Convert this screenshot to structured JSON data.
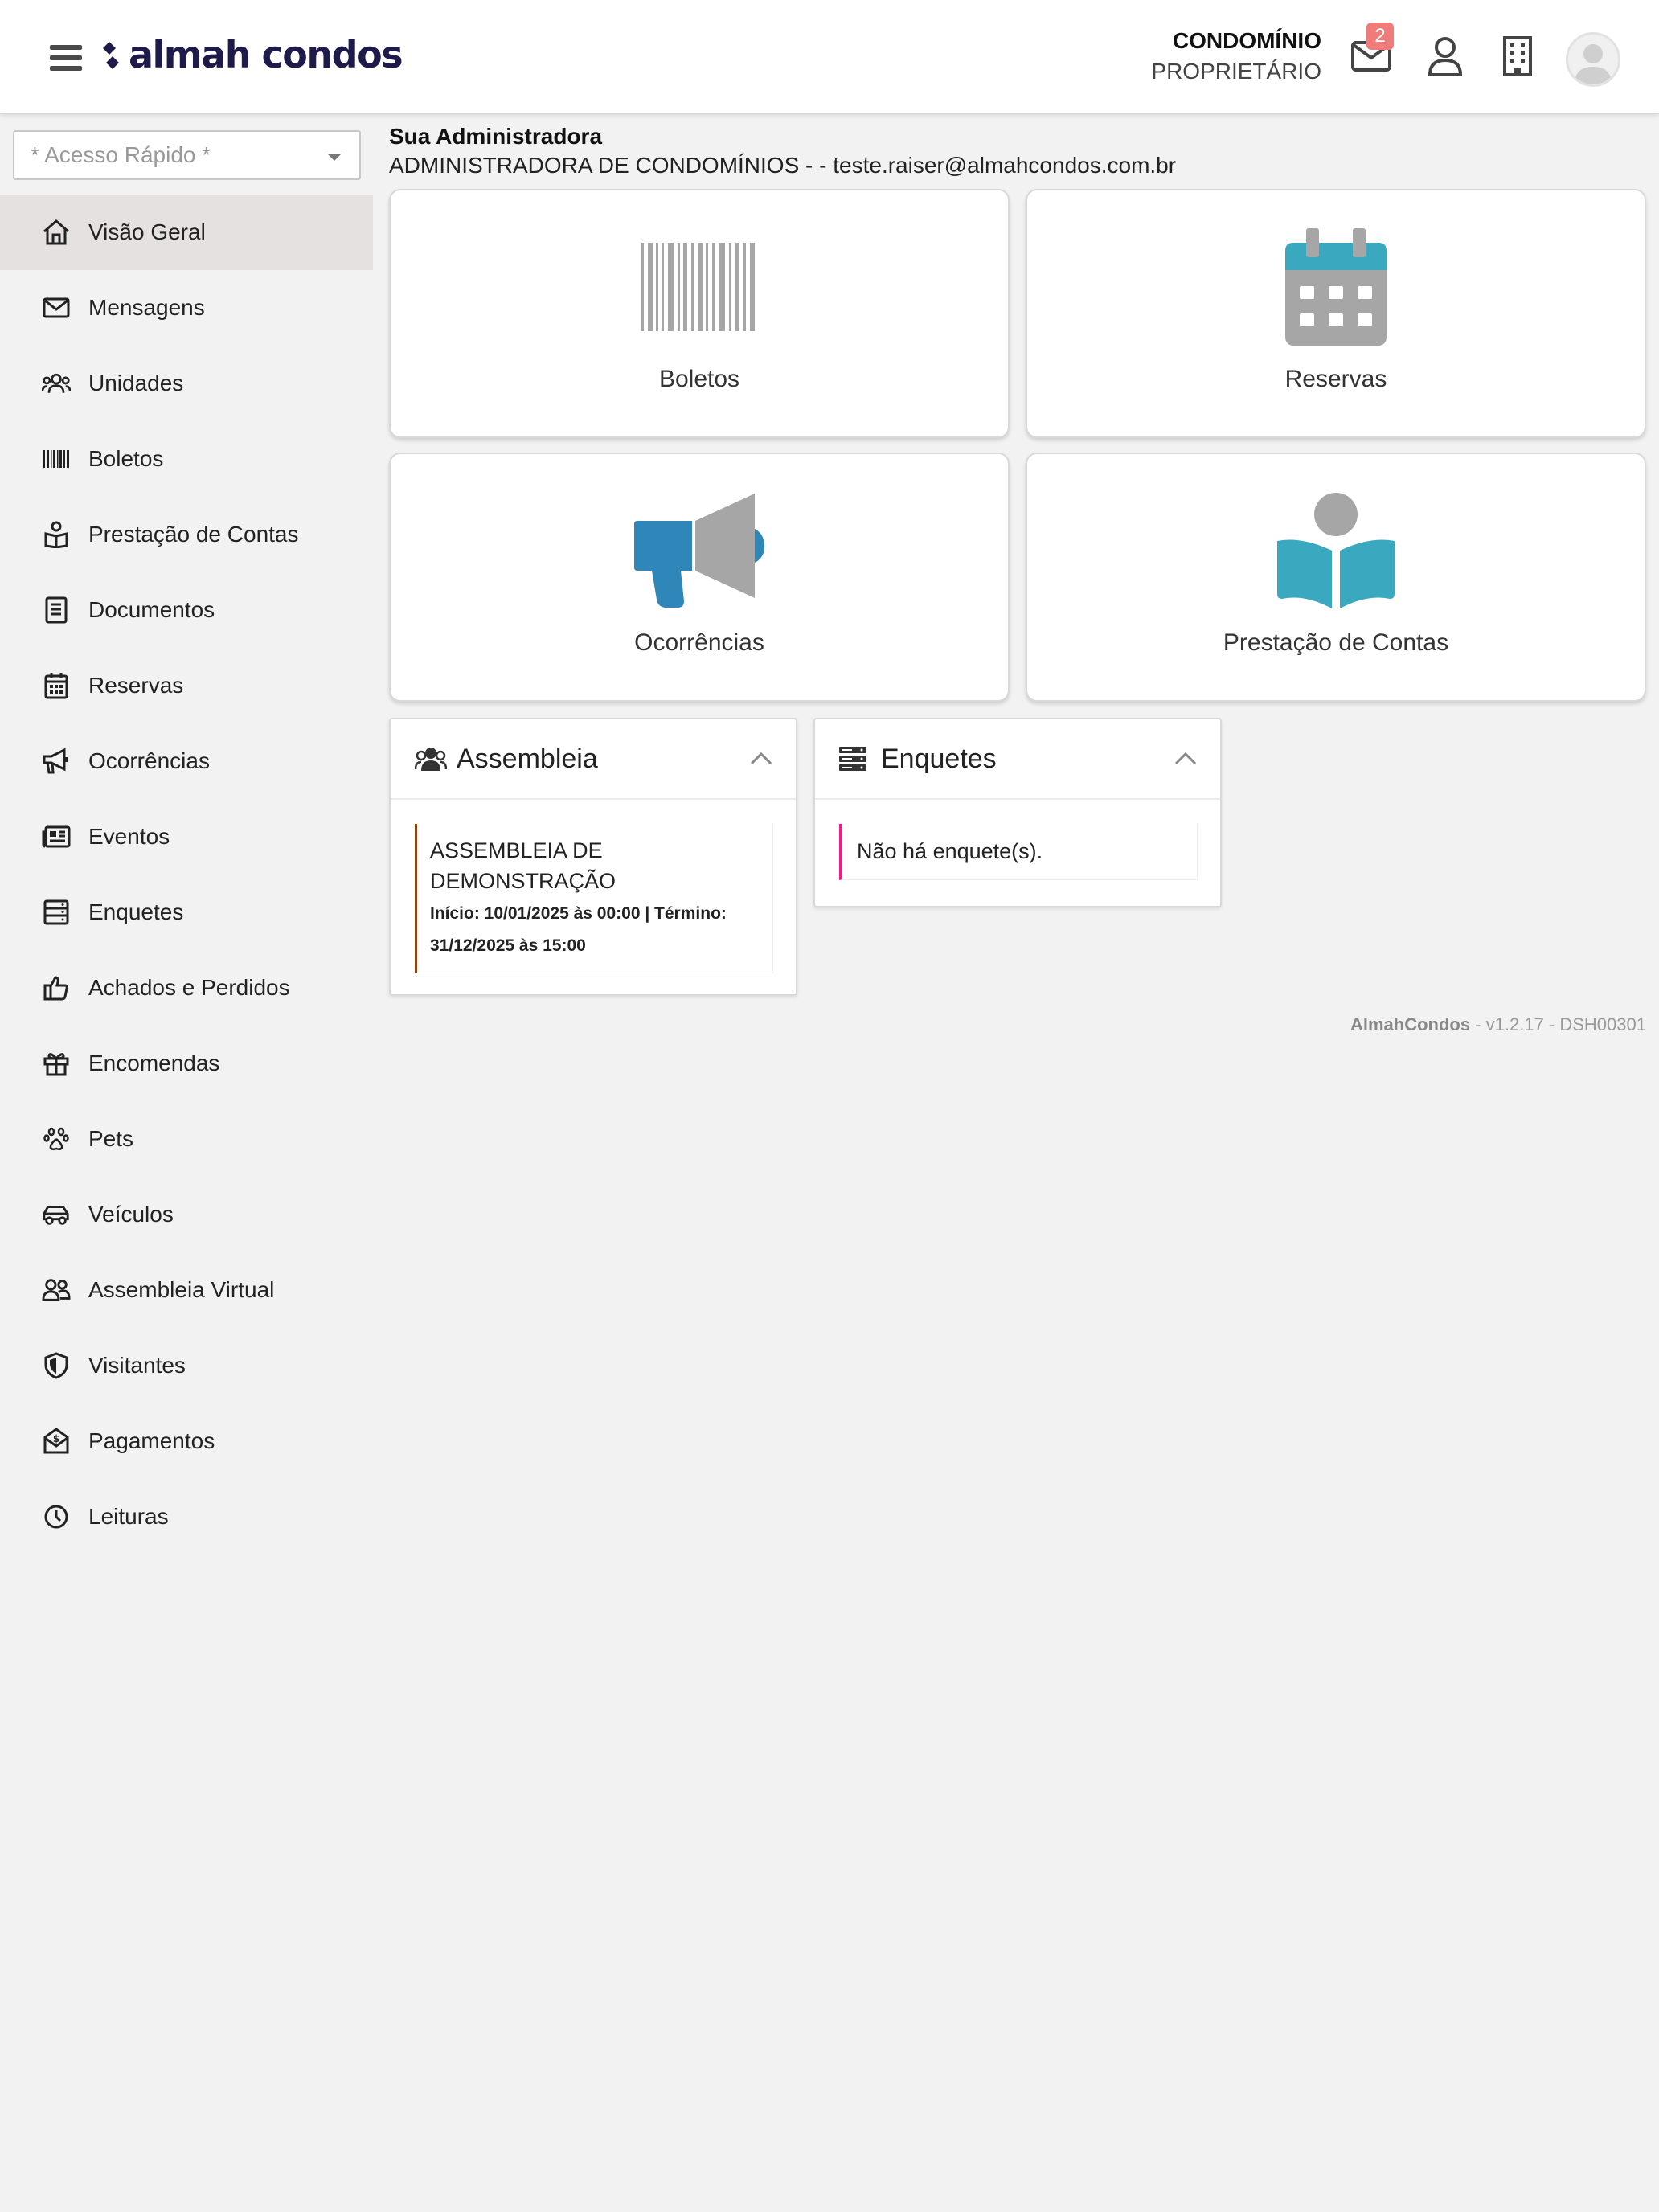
{
  "header": {
    "logo_text": "almah condos",
    "role_line1": "CONDOMÍNIO",
    "role_line2": "PROPRIETÁRIO",
    "unread_messages": "2",
    "icons": [
      "menu-icon",
      "mail-icon",
      "user-icon",
      "building-icon",
      "avatar"
    ]
  },
  "sidebar": {
    "quick_access_placeholder": "* Acesso Rápido *",
    "items": [
      {
        "label": "Visão Geral",
        "icon": "home-icon"
      },
      {
        "label": "Mensagens",
        "icon": "envelope-icon"
      },
      {
        "label": "Unidades",
        "icon": "users-icon"
      },
      {
        "label": "Boletos",
        "icon": "barcode-icon"
      },
      {
        "label": "Prestação de Contas",
        "icon": "book-user-icon"
      },
      {
        "label": "Documentos",
        "icon": "document-icon"
      },
      {
        "label": "Reservas",
        "icon": "calendar-icon"
      },
      {
        "label": "Ocorrências",
        "icon": "megaphone-icon"
      },
      {
        "label": "Eventos",
        "icon": "newspaper-icon"
      },
      {
        "label": "Enquetes",
        "icon": "server-icon"
      },
      {
        "label": "Achados e Perdidos",
        "icon": "thumbs-up-icon"
      },
      {
        "label": "Encomendas",
        "icon": "gift-icon"
      },
      {
        "label": "Pets",
        "icon": "paw-icon"
      },
      {
        "label": "Veículos",
        "icon": "car-icon"
      },
      {
        "label": "Assembleia Virtual",
        "icon": "user-group-icon"
      },
      {
        "label": "Visitantes",
        "icon": "shield-icon"
      },
      {
        "label": "Pagamentos",
        "icon": "money-envelope-icon"
      },
      {
        "label": "Leituras",
        "icon": "clock-icon"
      }
    ]
  },
  "main": {
    "admin_title": "Sua Administradora",
    "admin_info": "ADMINISTRADORA DE CONDOMÍNIOS - - teste.raiser@almahcondos.com.br",
    "tiles": [
      {
        "label": "Boletos",
        "icon": "barcode-icon"
      },
      {
        "label": "Reservas",
        "icon": "calendar-icon"
      },
      {
        "label": "Ocorrências",
        "icon": "megaphone-icon"
      },
      {
        "label": "Prestação de Contas",
        "icon": "reading-person-icon"
      }
    ],
    "assembleia": {
      "title": "Assembleia",
      "item_title": "ASSEMBLEIA DE DEMONSTRAÇÃO",
      "item_dates": "Início: 10/01/2025 às 00:00 | Término: 31/12/2025 às 15:00"
    },
    "enquetes": {
      "title": "Enquetes",
      "empty_text": "Não há enquete(s)."
    }
  },
  "footer": {
    "brand": "AlmahCondos",
    "version": " - v1.2.17 - DSH00301"
  },
  "colors": {
    "accent_blue": "#2f86b8",
    "teal": "#3aa8bf",
    "gray_icon": "#a6a6a6",
    "badge": "#ef7b7b",
    "brand_navy": "#1e1b4b",
    "assembleia_border": "#8b4513",
    "enquete_border": "#e91e8c"
  }
}
